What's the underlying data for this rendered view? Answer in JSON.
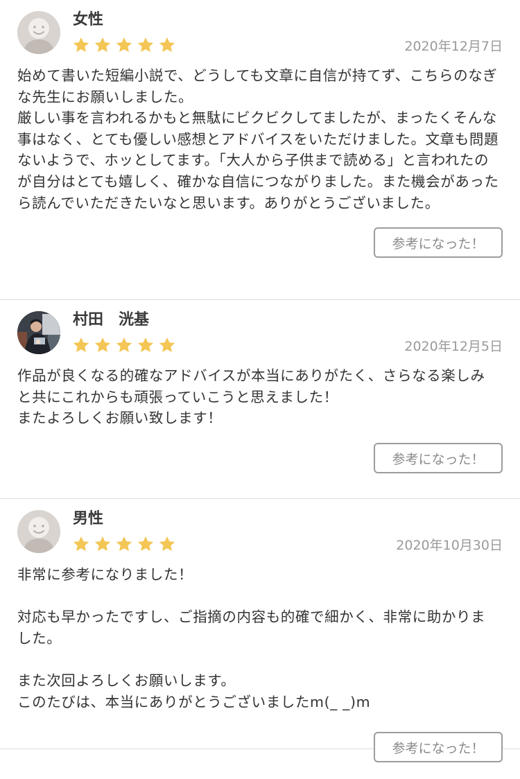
{
  "reviews": [
    {
      "name": "女性",
      "avatar": "default-avatar",
      "rating": 5,
      "date": "2020年12月7日",
      "body": "始めて書いた短編小説で、どうしても文章に自信が持てず、こちらのなぎな先生にお願いしました。\n厳しい事を言われるかもと無駄にビクビクしてましたが、まったくそんな事はなく、とても優しい感想とアドバイスをいただけました。文章も問題ないようで、ホッとしてます。「大人から子供まで読める」と言われたのが自分はとても嬉しく、確かな自信につながりました。また機会があったら読んでいただきたいなと思います。ありがとうございました。",
      "helpful_label": "参考になった！"
    },
    {
      "name": "村田　洸基",
      "avatar": "photo-avatar",
      "rating": 5,
      "date": "2020年12月5日",
      "body": "作品が良くなる的確なアドバイスが本当にありがたく、さらなる楽しみと共にこれからも頑張っていこうと思えました！\nまたよろしくお願い致します！",
      "helpful_label": "参考になった！"
    },
    {
      "name": "男性",
      "avatar": "default-avatar",
      "rating": 5,
      "date": "2020年10月30日",
      "body": "非常に参考になりました！\n\n対応も早かったですし、ご指摘の内容も的確で細かく、非常に助かりました。\n\nまた次回よろしくお願いします。\nこのたびは、本当にありがとうございましたm(_ _)m",
      "helpful_label": "参考になった！"
    }
  ],
  "colors": {
    "star": "#f3c655",
    "divider": "#dcdcdc",
    "date": "#9a9a9a",
    "button_border": "#9c9c9c"
  },
  "icons": {
    "star": "star-icon",
    "default_avatar": "user-silhouette-icon"
  }
}
